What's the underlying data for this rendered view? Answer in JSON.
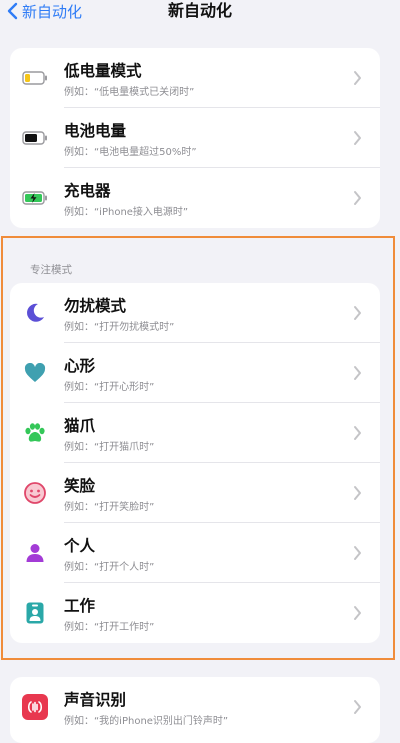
{
  "nav": {
    "back_label": "新自动化",
    "title": "新自动化"
  },
  "group1": {
    "items": [
      {
        "title": "低电量模式",
        "subtitle": "例如：“低电量模式已关闭时”",
        "icon": "low-battery-icon"
      },
      {
        "title": "电池电量",
        "subtitle": "例如：“电池电量超过50%时”",
        "icon": "battery-icon"
      },
      {
        "title": "充电器",
        "subtitle": "例如：“iPhone接入电源时”",
        "icon": "charging-battery-icon"
      }
    ]
  },
  "focus": {
    "header": "专注模式",
    "items": [
      {
        "title": "勿扰模式",
        "subtitle": "例如：“打开勿扰模式时”",
        "icon": "moon-icon"
      },
      {
        "title": "心形",
        "subtitle": "例如：“打开心形时”",
        "icon": "heart-icon"
      },
      {
        "title": "猫爪",
        "subtitle": "例如：“打开猫爪时”",
        "icon": "paw-icon"
      },
      {
        "title": "笑脸",
        "subtitle": "例如：“打开笑脸时”",
        "icon": "smiley-icon"
      },
      {
        "title": "个人",
        "subtitle": "例如：“打开个人时”",
        "icon": "person-icon"
      },
      {
        "title": "工作",
        "subtitle": "例如：“打开工作时”",
        "icon": "badge-icon"
      }
    ]
  },
  "group3": {
    "items": [
      {
        "title": "声音识别",
        "subtitle": "例如：“我的iPhone识别出门铃声时”",
        "icon": "sound-recognition-icon"
      }
    ]
  },
  "colors": {
    "accent": "#2f7cf6",
    "highlight_outline": "#f08c3a",
    "moon": "#5b4fd6",
    "heart": "#3fa0b0",
    "paw": "#34c759",
    "smiley": "#e0476a",
    "person": "#a33bd6",
    "badge": "#2aa8a8",
    "sound": "#e8384f"
  }
}
